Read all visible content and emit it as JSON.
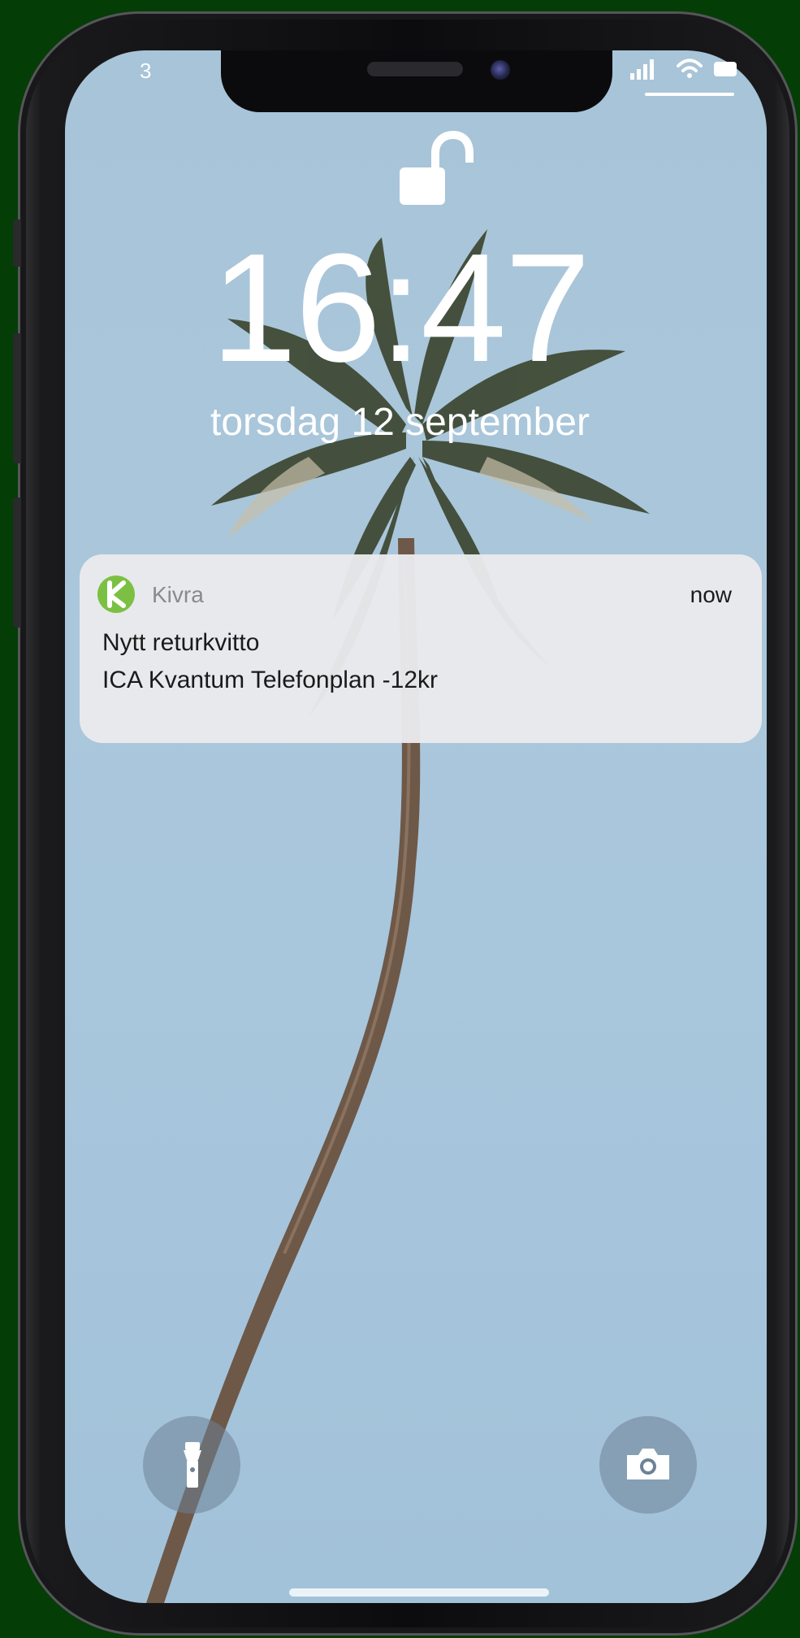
{
  "status_bar": {
    "carrier": "3",
    "icons": [
      "signal-icon",
      "wifi-icon",
      "battery-icon"
    ]
  },
  "lock_screen": {
    "lock_state": "unlocked-padlock-icon",
    "time": "16:47",
    "date": "torsdag 12 september"
  },
  "notification": {
    "app_name": "Kivra",
    "timestamp": "now",
    "title": "Nytt returkvitto",
    "body": "ICA Kvantum Telefonplan -12kr",
    "app_color": "#7bc043"
  },
  "quick_actions": {
    "left": "flashlight-icon",
    "right": "camera-icon"
  },
  "colors": {
    "sky": "#a8c4d8",
    "background": "#043d06"
  }
}
